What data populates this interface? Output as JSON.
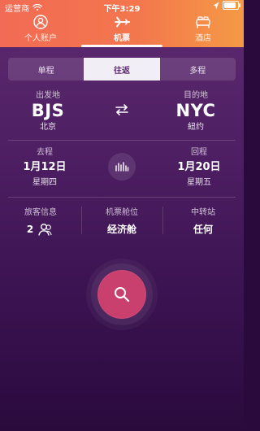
{
  "status_bar": {
    "carrier": "运营商",
    "time": "下午3:29",
    "battery_level": 0.85
  },
  "tabs": [
    {
      "label": "个人账户",
      "icon": "user-icon",
      "active": false
    },
    {
      "label": "机票",
      "icon": "plane-icon",
      "active": true
    },
    {
      "label": "酒店",
      "icon": "bed-icon",
      "active": false
    }
  ],
  "trip_type": {
    "options": [
      "单程",
      "往返",
      "多程"
    ],
    "selected": "往返"
  },
  "route": {
    "origin_label": "出发地",
    "origin_code": "BJS",
    "origin_city": "北京",
    "destination_label": "目的地",
    "destination_code": "NYC",
    "destination_city": "紐约"
  },
  "dates": {
    "depart_label": "去程",
    "depart_date": "1月12日",
    "depart_weekday": "星期四",
    "return_label": "回程",
    "return_date": "1月20日",
    "return_weekday": "星期五"
  },
  "info": {
    "passenger_label": "旅客信息",
    "passenger_count": "2",
    "cabin_label": "机票舱位",
    "cabin_value": "经济舱",
    "transfer_label": "中转站",
    "transfer_value": "任何"
  },
  "colors": {
    "header_gradient_left": "#f26b55",
    "header_gradient_right": "#f49a45",
    "search_button": "#c93f6e",
    "background_top": "#5d2a70",
    "background_bottom": "#2a0a3d"
  }
}
